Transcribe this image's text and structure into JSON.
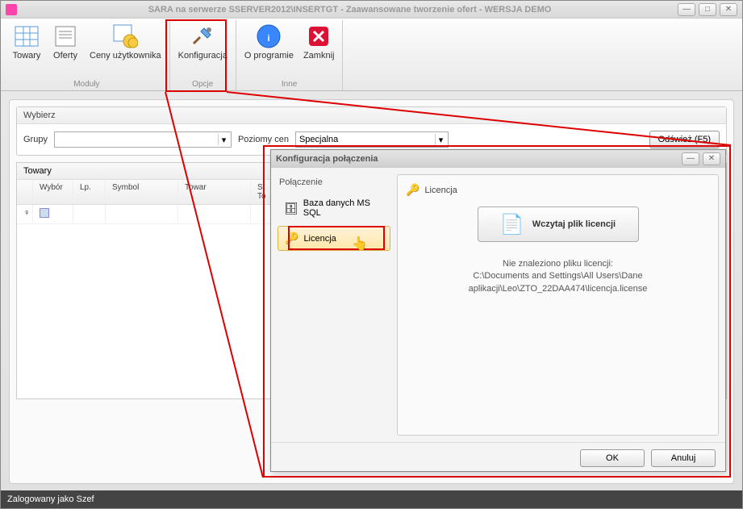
{
  "main": {
    "title": "SARA na serwerze SSERVER2012\\INSERTGT - Zaawansowane tworzenie ofert - WERSJA DEMO",
    "ribbon": {
      "groups": [
        {
          "label": "Moduły",
          "items": [
            "Towary",
            "Oferty",
            "Ceny użytkownika"
          ]
        },
        {
          "label": "Opcje",
          "items": [
            "Konfiguracja"
          ]
        },
        {
          "label": "Inne",
          "items": [
            "O programie",
            "Zamknij"
          ]
        }
      ]
    },
    "wybierz": {
      "title": "Wybierz",
      "grupy_label": "Grupy",
      "poziomy_label": "Poziomy cen",
      "poziomy_value": "Specjalna",
      "refresh": "Odśwież (F5)"
    },
    "grid": {
      "title": "Towary",
      "cols": [
        "Wybór",
        "Lp.",
        "Symbol",
        "Towar",
        "St To"
      ]
    },
    "status": "Zalogowany jako Szef"
  },
  "dialog": {
    "title": "Konfiguracja połączenia",
    "side_title": "Połączenie",
    "side_items": [
      "Baza danych MS SQL",
      "Licencja"
    ],
    "panel_title": "Licencja",
    "load_btn": "Wczytaj plik licencji",
    "info1": "Nie znaleziono pliku licencji:",
    "info2": "C:\\Documents and Settings\\All Users\\Dane aplikacji\\Leo\\ZTO_22DAA474\\licencja.license",
    "ok": "OK",
    "cancel": "Anuluj"
  }
}
